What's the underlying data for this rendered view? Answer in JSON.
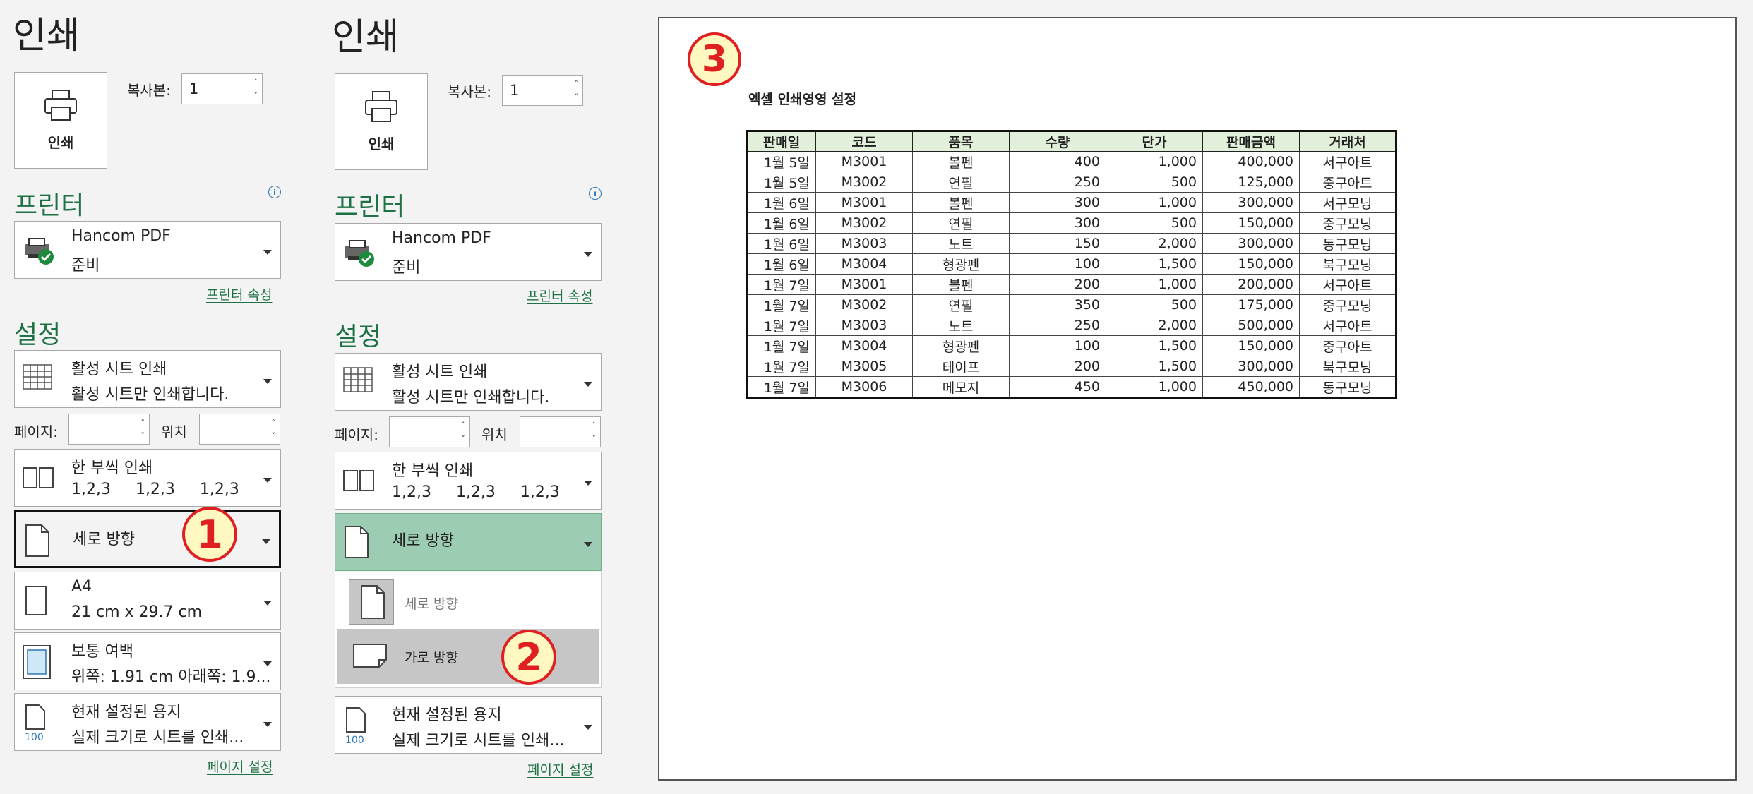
{
  "title": "인쇄",
  "print_button": "인쇄",
  "copies_label": "복사본:",
  "copies_value": "1",
  "printer_section": "프린터",
  "printer_name": "Hancom PDF",
  "printer_status": "준비",
  "printer_props_link": "프린터 속성",
  "settings_section": "설정",
  "active_sheet": {
    "line1": "활성 시트 인쇄",
    "line2": "활성 시트만 인쇄합니다."
  },
  "pages_label": "페이지:",
  "to_label": "위치",
  "collate": {
    "line1": "한 부씩 인쇄",
    "line2": "1,2,3     1,2,3     1,2,3"
  },
  "orientation": {
    "current": "세로 방향"
  },
  "paper": {
    "line1": "A4",
    "line2": "21 cm x 29.7 cm"
  },
  "margins": {
    "line1": "보통 여백",
    "line2": "위쪽: 1.91 cm 아래쪽: 1.9..."
  },
  "scaling": {
    "line1": "현재 설정된 용지",
    "line2_left": "실제 크기로 시트를 인쇄...",
    "line2_right": "실제 크기로 시트를 인쇄..."
  },
  "page_setup_link": "페이지 설정",
  "orientation_menu": {
    "portrait": "세로 방향",
    "landscape": "가로 방향"
  },
  "callouts": {
    "one": "1",
    "two": "2",
    "three": "3"
  },
  "sheet": {
    "title": "엑셀 인쇄영영 설정",
    "columns": [
      "판매일",
      "코드",
      "품목",
      "수량",
      "단가",
      "판매금액",
      "거래처"
    ],
    "rows": [
      [
        "1월 5일",
        "M3001",
        "볼펜",
        "400",
        "1,000",
        "400,000",
        "서구아트"
      ],
      [
        "1월 5일",
        "M3002",
        "연필",
        "250",
        "500",
        "125,000",
        "중구아트"
      ],
      [
        "1월 6일",
        "M3001",
        "볼펜",
        "300",
        "1,000",
        "300,000",
        "서구모닝"
      ],
      [
        "1월 6일",
        "M3002",
        "연필",
        "300",
        "500",
        "150,000",
        "중구모닝"
      ],
      [
        "1월 6일",
        "M3003",
        "노트",
        "150",
        "2,000",
        "300,000",
        "동구모닝"
      ],
      [
        "1월 6일",
        "M3004",
        "형광펜",
        "100",
        "1,500",
        "150,000",
        "북구모닝"
      ],
      [
        "1월 7일",
        "M3001",
        "볼펜",
        "200",
        "1,000",
        "200,000",
        "서구아트"
      ],
      [
        "1월 7일",
        "M3002",
        "연필",
        "350",
        "500",
        "175,000",
        "중구모닝"
      ],
      [
        "1월 7일",
        "M3003",
        "노트",
        "250",
        "2,000",
        "500,000",
        "서구아트"
      ],
      [
        "1월 7일",
        "M3004",
        "형광펜",
        "100",
        "1,500",
        "150,000",
        "중구아트"
      ],
      [
        "1월 7일",
        "M3005",
        "테이프",
        "200",
        "1,500",
        "300,000",
        "북구모닝"
      ],
      [
        "1월 7일",
        "M3006",
        "메모지",
        "450",
        "1,000",
        "450,000",
        "동구모닝"
      ]
    ]
  },
  "colors": {
    "accent_green": "#1e7145",
    "selected_bg": "#9ccdb3",
    "highlight_bg": "#c6c6c6",
    "callout_red": "#e02020",
    "callout_fill": "#fff8c0",
    "header_green": "#e2efda"
  }
}
